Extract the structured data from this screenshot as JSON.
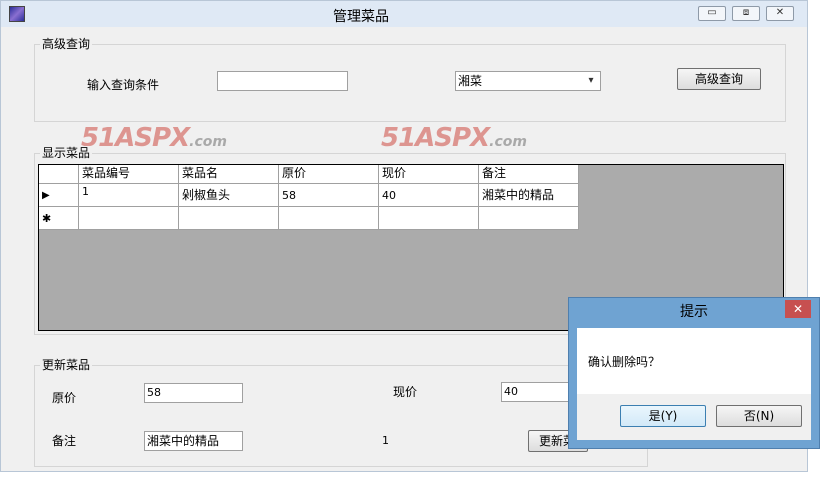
{
  "window": {
    "title": "管理菜品",
    "minimize": "▭",
    "maximize": "⧈",
    "close": "✕"
  },
  "advanced_query": {
    "group_label": "高级查询",
    "condition_label": "输入查询条件",
    "condition_value": "",
    "category_selected": "湘菜",
    "query_button": "高级查询"
  },
  "watermarks": [
    {
      "main": "51ASPX",
      "suffix": ".com"
    },
    {
      "main": "51ASPX",
      "suffix": ".com"
    }
  ],
  "display": {
    "group_label": "显示菜品",
    "columns": [
      "菜品编号",
      "菜品名",
      "原价",
      "现价",
      "备注"
    ],
    "rows": [
      {
        "marker": "▶",
        "cells": [
          "1",
          "剁椒鱼头",
          "58",
          "40",
          "湘菜中的精品"
        ]
      },
      {
        "marker": "✱",
        "cells": [
          "",
          "",
          "",
          "",
          ""
        ]
      }
    ]
  },
  "update": {
    "group_label": "更新菜品",
    "original_price_label": "原价",
    "original_price_value": "58",
    "current_price_label": "现价",
    "current_price_value": "40",
    "remark_label": "备注",
    "remark_value": "湘菜中的精品",
    "id_value": "1",
    "update_button": "更新菜"
  },
  "dialog": {
    "title": "提示",
    "close": "✕",
    "message": "确认删除吗？",
    "yes_button": "是(Y)",
    "no_button": "否(N)"
  }
}
